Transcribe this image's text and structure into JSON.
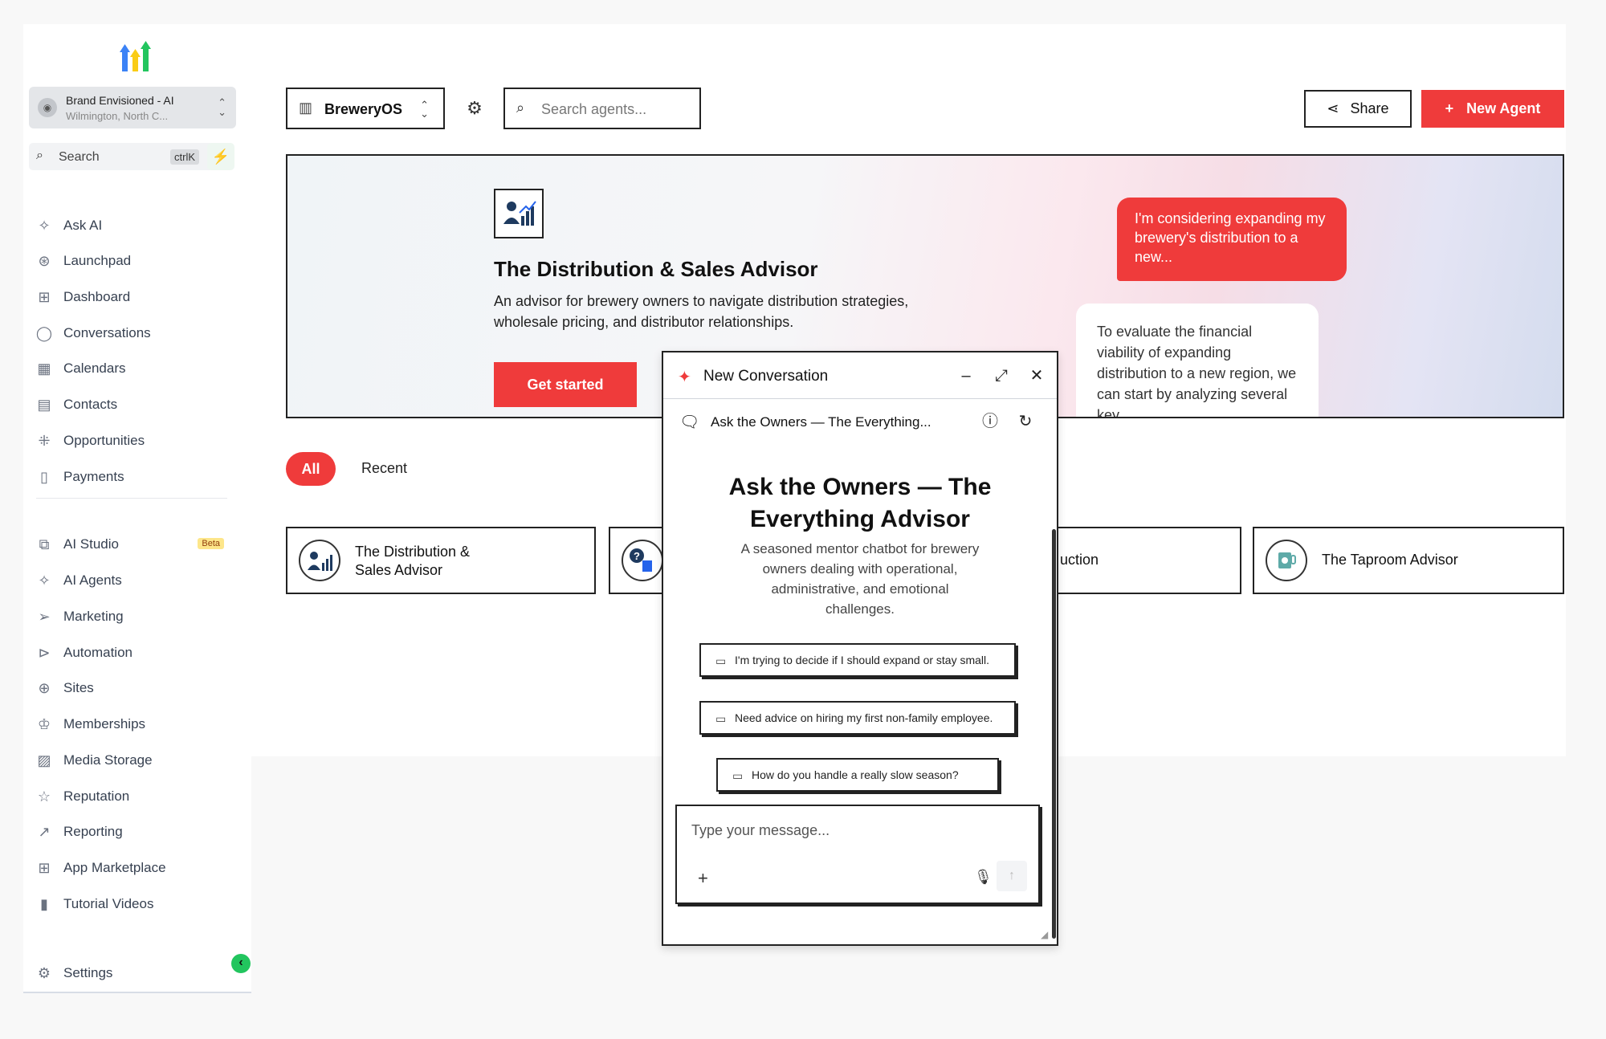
{
  "sidebar": {
    "account": {
      "name": "Brand Envisioned - AI",
      "location": "Wilmington, North C..."
    },
    "search": {
      "label": "Search",
      "shortcut": "ctrlK"
    },
    "items": [
      {
        "label": "Ask AI",
        "icon": "sparkle-icon"
      },
      {
        "label": "Launchpad",
        "icon": "rocket-icon"
      },
      {
        "label": "Dashboard",
        "icon": "grid-icon"
      },
      {
        "label": "Conversations",
        "icon": "chat-icon"
      },
      {
        "label": "Calendars",
        "icon": "calendar-icon"
      },
      {
        "label": "Contacts",
        "icon": "contacts-icon"
      },
      {
        "label": "Opportunities",
        "icon": "network-icon"
      },
      {
        "label": "Payments",
        "icon": "receipt-icon"
      }
    ],
    "items2": [
      {
        "label": "AI Studio",
        "icon": "ai-studio-icon",
        "badge": "Beta"
      },
      {
        "label": "AI Agents",
        "icon": "sparkle-icon"
      },
      {
        "label": "Marketing",
        "icon": "send-icon"
      },
      {
        "label": "Automation",
        "icon": "play-icon"
      },
      {
        "label": "Sites",
        "icon": "globe-icon"
      },
      {
        "label": "Memberships",
        "icon": "award-icon"
      },
      {
        "label": "Media Storage",
        "icon": "image-icon"
      },
      {
        "label": "Reputation",
        "icon": "star-icon"
      },
      {
        "label": "Reporting",
        "icon": "trend-icon"
      },
      {
        "label": "App Marketplace",
        "icon": "apps-icon"
      },
      {
        "label": "Tutorial Videos",
        "icon": "video-file-icon"
      }
    ],
    "settings": {
      "label": "Settings",
      "icon": "gear-icon"
    }
  },
  "toolbar": {
    "workspace": "BreweryOS",
    "search_placeholder": "Search agents...",
    "share_label": "Share",
    "new_agent_label": "New Agent"
  },
  "hero": {
    "title": "The Distribution & Sales Advisor",
    "description": "An advisor for brewery owners to navigate distribution strategies, wholesale pricing, and distributor relationships.",
    "cta": "Get started",
    "user_bubble": "I'm considering expanding my brewery's distribution to a new...",
    "ai_bubble": "To evaluate the financial viability of expanding distribution to a new region, we can start by analyzing several key..."
  },
  "tabs": {
    "all": "All",
    "recent": "Recent"
  },
  "cards": [
    {
      "label": "The Distribution & Sales Advisor"
    },
    {
      "label": ""
    },
    {
      "label": "uction"
    },
    {
      "label": "The Taproom Advisor"
    }
  ],
  "chat": {
    "header_title": "New Conversation",
    "agent_name": "Ask the Owners — The Everything...",
    "title": "Ask the Owners — The Everything Advisor",
    "description": "A seasoned mentor chatbot for brewery owners dealing with operational, administrative, and emotional challenges.",
    "suggestions": [
      "I'm trying to decide if I should expand or stay small.",
      "Need advice on hiring my first non-family employee.",
      "How do you handle a really slow season?"
    ],
    "input_placeholder": "Type your message..."
  },
  "colors": {
    "accent": "#ef3b3b",
    "success": "#22c55e"
  }
}
